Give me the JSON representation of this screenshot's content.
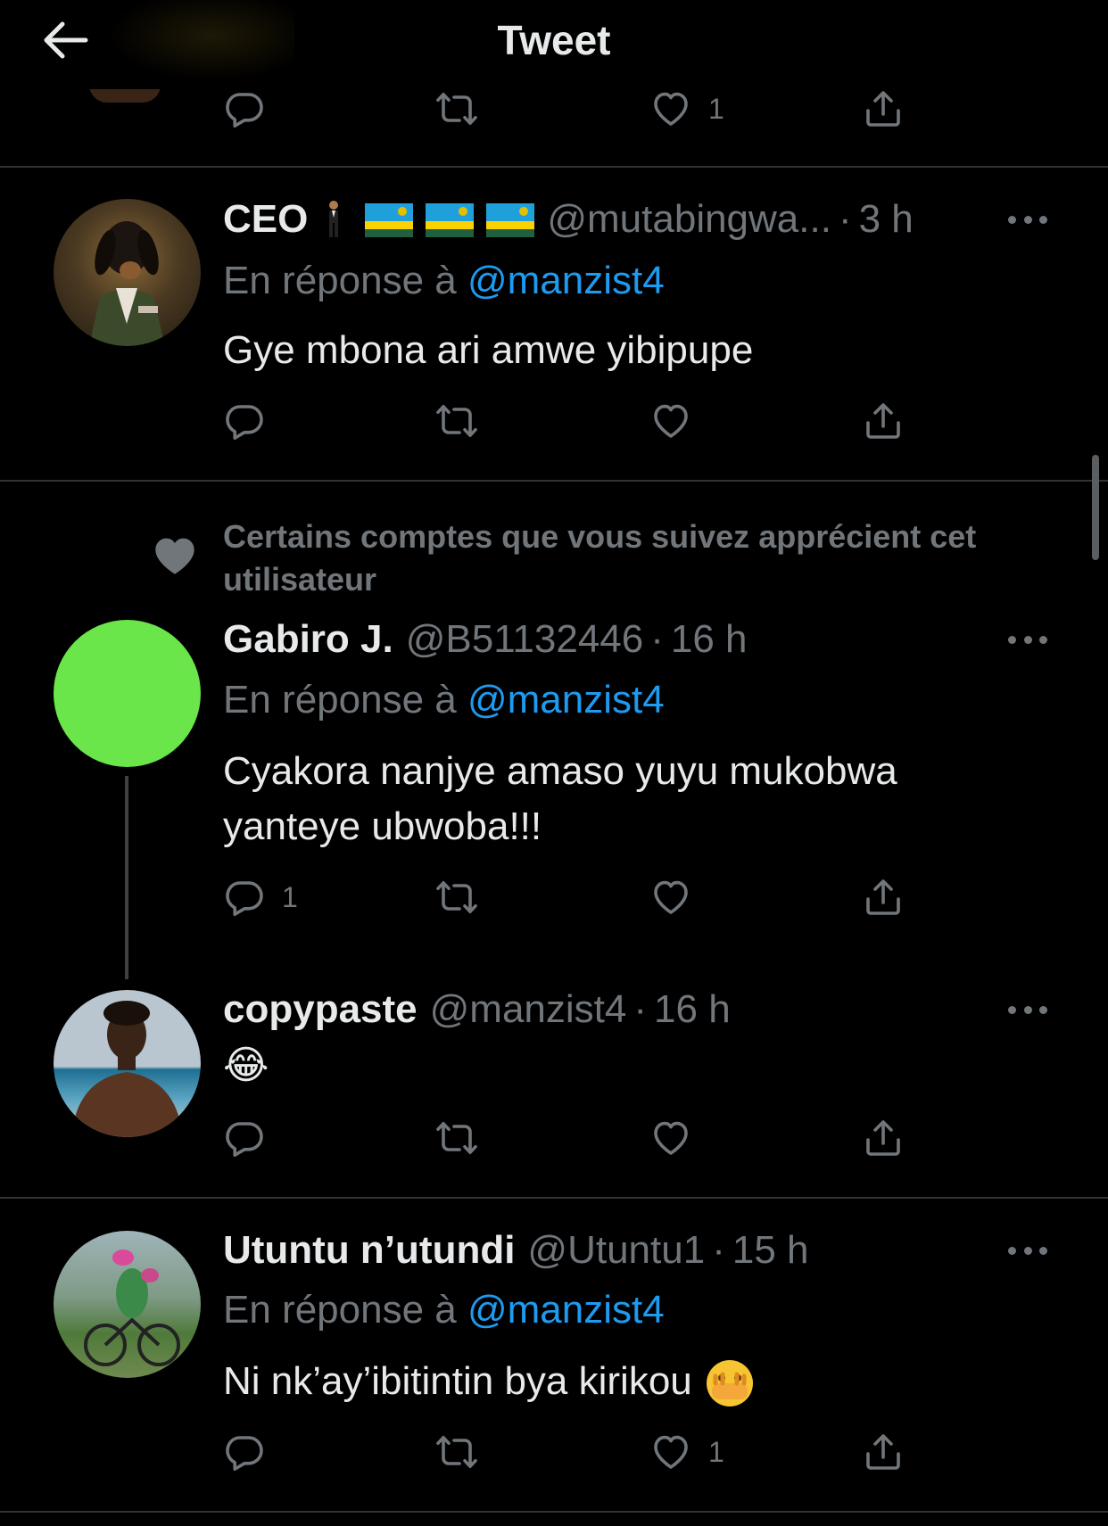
{
  "header": {
    "title": "Tweet"
  },
  "top_partial": {
    "like_count": "1"
  },
  "social_context": "Certains comptes que vous suivez apprécient cet utilisateur",
  "tweets": [
    {
      "name": "CEO",
      "handle": "@mutabingwa...",
      "time": "3 h",
      "reply_prefix": "En réponse à",
      "mention": "@manzist4",
      "text": "Gye mbona ari amwe yibipupe",
      "reply_count": "",
      "like_count": ""
    },
    {
      "name": "Gabiro J.",
      "handle": "@B51132446",
      "time": "16 h",
      "reply_prefix": "En réponse à",
      "mention": "@manzist4",
      "text": "Cyakora nanjye amaso yuyu mukobwa yanteye ubwoba!!!",
      "reply_count": "1",
      "like_count": "",
      "avatar_color": "#6ae64a"
    },
    {
      "name": "copypaste",
      "handle": "@manzist4",
      "time": "16 h",
      "text": "😂",
      "reply_count": "",
      "like_count": ""
    },
    {
      "name": "Utuntu n’utundi",
      "handle": "@Utuntu1",
      "time": "15 h",
      "reply_prefix": "En réponse à",
      "mention": "@manzist4",
      "text": "Ni nk’ay’ibitintin bya kirikou",
      "reply_count": "",
      "like_count": "1"
    }
  ],
  "icons": {
    "back": "arrow-left-icon",
    "reply": "reply-icon",
    "retweet": "retweet-icon",
    "like": "heart-icon",
    "share": "share-icon",
    "more": "more-icon"
  },
  "colors": {
    "background": "#000000",
    "text": "#e7e9ea",
    "muted": "#71767b",
    "link": "#1d9bf0",
    "divider": "#2f3336"
  }
}
